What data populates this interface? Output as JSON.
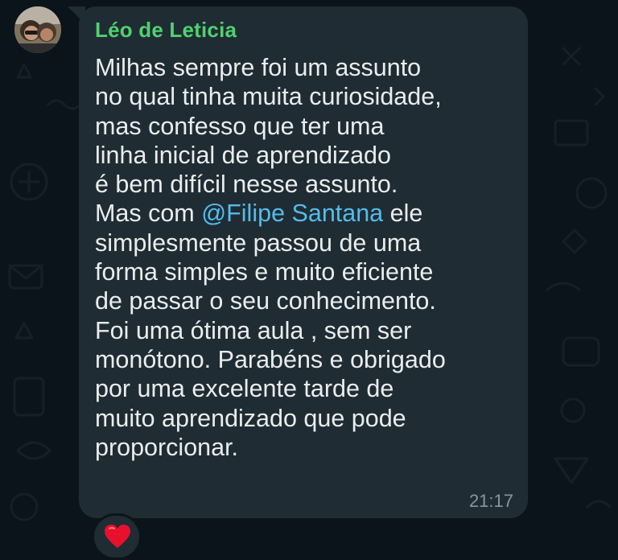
{
  "chat": {
    "sender_name": "Léo de Leticia",
    "message_lines": [
      "Milhas sempre foi um assunto",
      "no qual tinha muita curiosidade,",
      "mas confesso que ter uma",
      "linha inicial de aprendizado",
      "é bem difícil nesse assunto.",
      "",
      "simplesmente passou de uma",
      "forma simples e muito eficiente",
      "de passar o seu conhecimento.",
      "Foi uma ótima aula , sem ser",
      "monótono. Parabéns e obrigado",
      "por uma excelente tarde de",
      "muito aprendizado que pode",
      "proporcionar."
    ],
    "mention_prefix": "Mas com ",
    "mention": "@Filipe Santana",
    "mention_suffix": " ele",
    "timestamp": "21:17",
    "reaction_icon": "red-heart-icon"
  },
  "colors": {
    "background": "#0b141a",
    "bubble": "#202c33",
    "sender_name": "#4fd16f",
    "text": "#e9edef",
    "mention": "#53bdeb",
    "timestamp": "#8696a0",
    "heart": "#e8112d"
  }
}
